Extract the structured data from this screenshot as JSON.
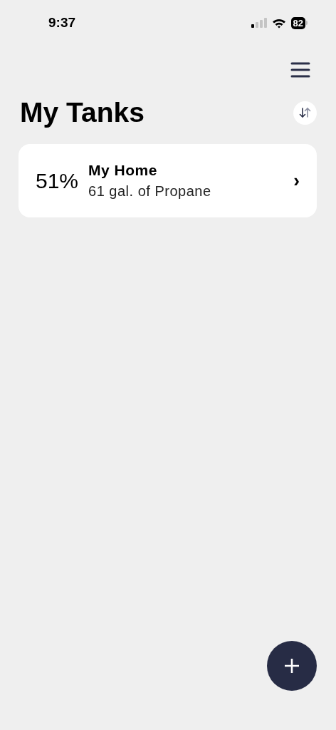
{
  "status_bar": {
    "time": "9:37",
    "battery": "82"
  },
  "title": "My Tanks",
  "tanks": [
    {
      "percent": "51%",
      "name": "My Home",
      "amount": "61 gal. of Propane",
      "chevron": "›"
    }
  ]
}
